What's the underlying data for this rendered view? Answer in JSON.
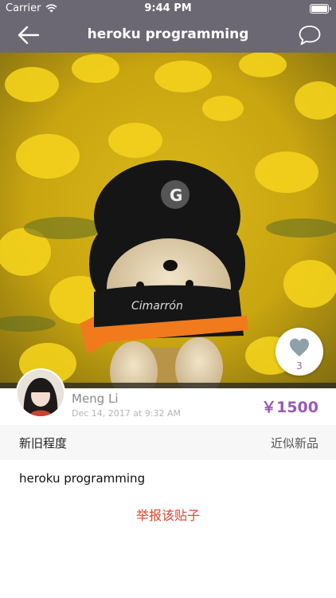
{
  "status_bar": {
    "carrier": "Carrier",
    "time": "9:44 PM"
  },
  "nav": {
    "title": "heroku programming"
  },
  "post": {
    "like_count": "3",
    "seller_name": "Meng Li",
    "posted_at": "Dec 14, 2017 at 9:32 AM",
    "price": "￥1500",
    "condition_label": "新旧程度",
    "condition_value": "近似新品",
    "description": "heroku programming",
    "report_label": "举报该贴子"
  },
  "colors": {
    "nav_bg": "#6b6773",
    "price": "#9b59b6",
    "report": "#e0442d",
    "heart": "#8fa0ab"
  }
}
